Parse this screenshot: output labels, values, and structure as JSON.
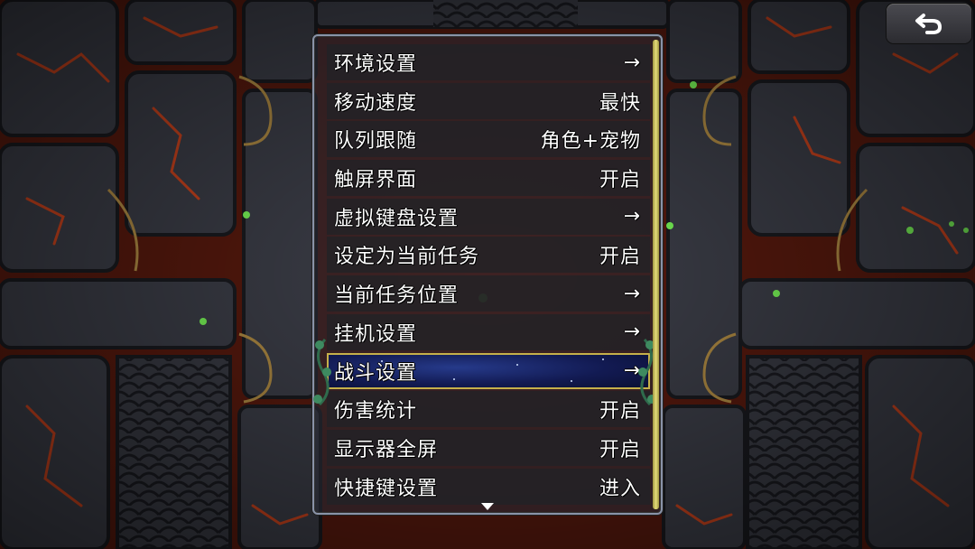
{
  "menu": {
    "items": [
      {
        "label": "环境设置",
        "value": "→"
      },
      {
        "label": "移动速度",
        "value": "最快"
      },
      {
        "label": "队列跟随",
        "value": "角色+宠物"
      },
      {
        "label": "触屏界面",
        "value": "开启"
      },
      {
        "label": "虚拟键盘设置",
        "value": "→"
      },
      {
        "label": "设定为当前任务",
        "value": "开启"
      },
      {
        "label": "当前任务位置",
        "value": "→"
      },
      {
        "label": "挂机设置",
        "value": "→"
      },
      {
        "label": "战斗设置",
        "value": "→"
      },
      {
        "label": "伤害统计",
        "value": "开启"
      },
      {
        "label": "显示器全屏",
        "value": "开启"
      },
      {
        "label": "快捷键设置",
        "value": "进入"
      }
    ],
    "selected_index": 8,
    "scroll_position": 0
  },
  "icons": {
    "back": "undo-arrow-icon",
    "scroll_more": "chevron-down-icon"
  },
  "colors": {
    "lava": "#e0461a",
    "stone": "#3b3d47",
    "panel_border": "#8a93a8",
    "selection_border": "#c6b04a",
    "selection_fill": "#1a2466",
    "scrollbar": "#e6dc7a",
    "firefly": "#7dff5a"
  }
}
